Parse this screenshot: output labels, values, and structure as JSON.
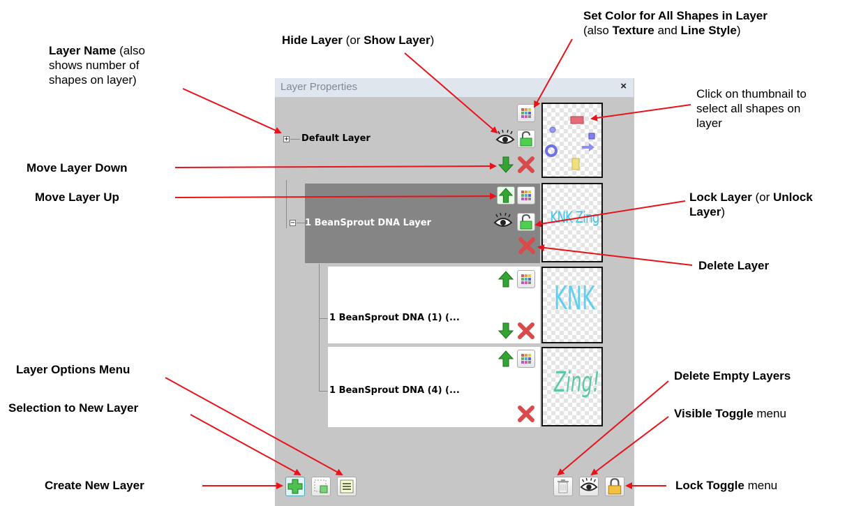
{
  "panel": {
    "title": "Layer Properties",
    "close_glyph": "×"
  },
  "layers": [
    {
      "name": "Default Layer",
      "expander": "+",
      "thumb_text": ""
    },
    {
      "name": "1 BeanSprout DNA Layer",
      "expander": "−",
      "thumb_text": "KNK Zing!"
    },
    {
      "name": "1 BeanSprout DNA (1) (...",
      "thumb_text": "KNK"
    },
    {
      "name": "1 BeanSprout DNA (4) (...",
      "thumb_text": "Zing!"
    }
  ],
  "annotations": {
    "layer_name": {
      "bold": "Layer Name",
      "rest1": " (also",
      "line2": "shows number of",
      "line3": "shapes on layer)"
    },
    "hide_layer": {
      "bold1": "Hide Layer",
      "mid": " (or ",
      "bold2": "Show Layer",
      "end": ")"
    },
    "set_color": {
      "bold1": "Set Color for All Shapes in Layer",
      "pre": "(also ",
      "bold2": "Texture",
      "mid": " and ",
      "bold3": "Line Style",
      "end": ")"
    },
    "thumbnail": {
      "line1": "Click on thumbnail to",
      "line2": "select all shapes on",
      "line3": "layer"
    },
    "move_down": "Move Layer Down",
    "move_up": "Move Layer Up",
    "lock_layer": {
      "bold1": "Lock Layer",
      "mid": " (or ",
      "bold2": "Unlock",
      "bold3": "Layer",
      "end": ")"
    },
    "delete_layer": "Delete Layer",
    "layer_options": "Layer Options Menu",
    "delete_empty": "Delete Empty Layers",
    "selection_new": "Selection to New Layer",
    "visible_toggle": {
      "bold": "Visible Toggle",
      "rest": " menu"
    },
    "create_new": "Create New Layer",
    "lock_toggle": {
      "bold": "Lock Toggle",
      "rest": " menu"
    }
  },
  "colors": {
    "arrow": "#e8121b",
    "selected_row": "#858585",
    "panel_bg": "#c6c6c6",
    "thumb_text": "#3fc3e6",
    "thumb_text_green": "#5cc8a8",
    "up_arrow": "#33a533",
    "delete_x": "#d94a4a"
  },
  "icons": [
    "color-grid-icon",
    "eye-icon",
    "lock-open-icon",
    "arrow-down-icon",
    "arrow-up-icon",
    "delete-x-icon",
    "add-layer-icon",
    "selection-to-layer-icon",
    "layer-options-icon",
    "trash-icon",
    "eye-toggle-icon",
    "lock-toggle-icon"
  ]
}
